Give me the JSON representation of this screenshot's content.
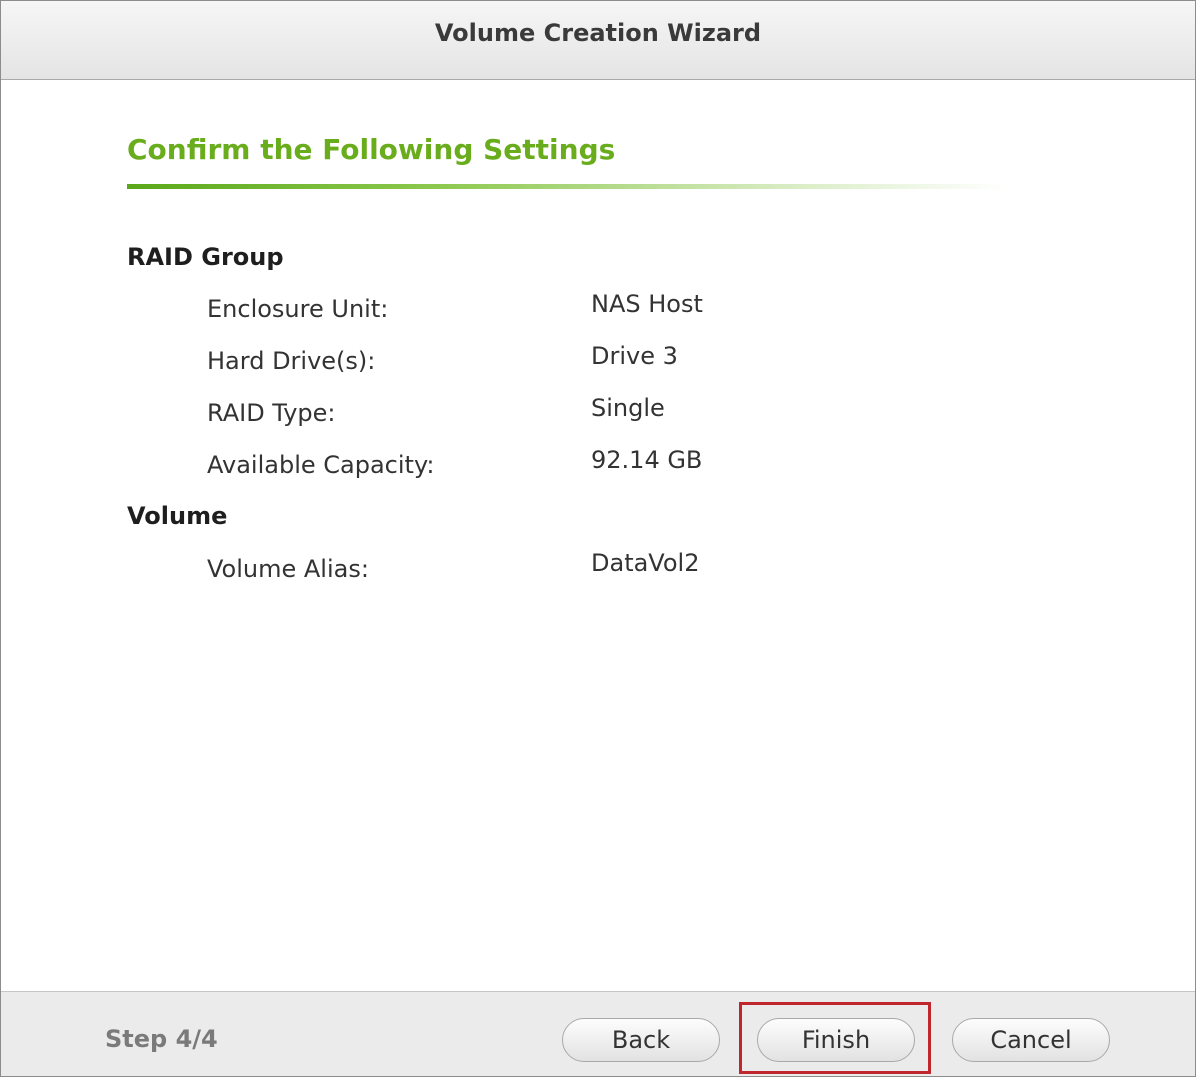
{
  "window": {
    "title": "Volume Creation Wizard"
  },
  "main": {
    "heading": "Confirm the Following Settings",
    "sections": [
      {
        "label": "RAID Group",
        "fields": [
          {
            "label": "Enclosure Unit:",
            "value": "NAS Host"
          },
          {
            "label": "Hard Drive(s):",
            "value": "Drive 3"
          },
          {
            "label": "RAID Type:",
            "value": "Single"
          },
          {
            "label": "Available Capacity:",
            "value": "92.14 GB"
          }
        ]
      },
      {
        "label": "Volume",
        "fields": [
          {
            "label": "Volume Alias:",
            "value": "DataVol2"
          }
        ]
      }
    ]
  },
  "footer": {
    "step": "Step 4/4",
    "back_label": "Back",
    "finish_label": "Finish",
    "cancel_label": "Cancel"
  },
  "colors": {
    "heading": "#6aad1c",
    "highlight": "#c0272d"
  }
}
